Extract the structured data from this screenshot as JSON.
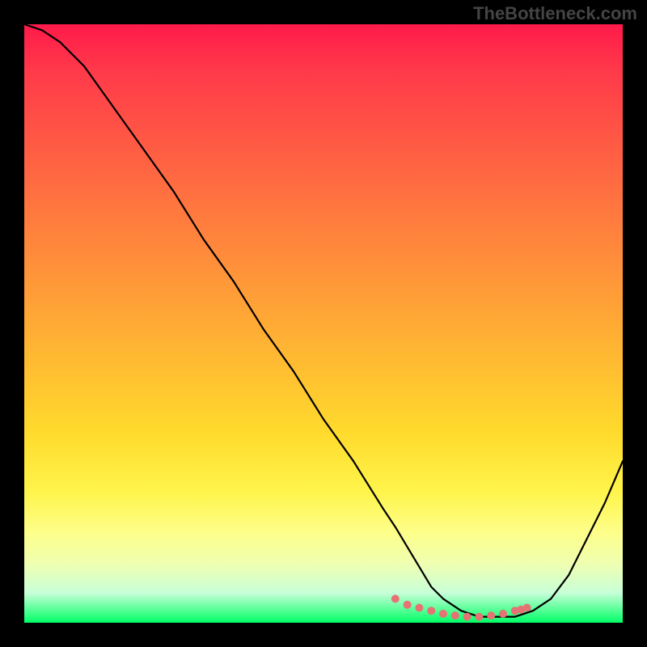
{
  "watermark": "TheBottleneck.com",
  "chart_data": {
    "type": "line",
    "title": "",
    "xlabel": "",
    "ylabel": "",
    "xlim": [
      0,
      100
    ],
    "ylim": [
      0,
      100
    ],
    "series": [
      {
        "name": "bottleneck-curve",
        "x": [
          0,
          3,
          6,
          10,
          15,
          20,
          25,
          30,
          35,
          40,
          45,
          50,
          55,
          60,
          62,
          65,
          68,
          70,
          73,
          76,
          79,
          82,
          85,
          88,
          91,
          94,
          97,
          100
        ],
        "values": [
          100,
          99,
          97,
          93,
          86,
          79,
          72,
          64,
          57,
          49,
          42,
          34,
          27,
          19,
          16,
          11,
          6,
          4,
          2,
          1,
          1,
          1,
          2,
          4,
          8,
          14,
          20,
          27
        ]
      }
    ],
    "markers": {
      "name": "optimal-range",
      "x": [
        62,
        64,
        66,
        68,
        70,
        72,
        74,
        76,
        78,
        80,
        82,
        83,
        84
      ],
      "values": [
        4,
        3,
        2.5,
        2,
        1.5,
        1.2,
        1,
        1,
        1.2,
        1.5,
        2,
        2.2,
        2.5
      ],
      "color": "#e57373"
    },
    "gradient_stops": [
      {
        "pos": 0,
        "color": "#ff1a4a"
      },
      {
        "pos": 50,
        "color": "#ffba32"
      },
      {
        "pos": 85,
        "color": "#fdff8a"
      },
      {
        "pos": 100,
        "color": "#00ff66"
      }
    ]
  }
}
